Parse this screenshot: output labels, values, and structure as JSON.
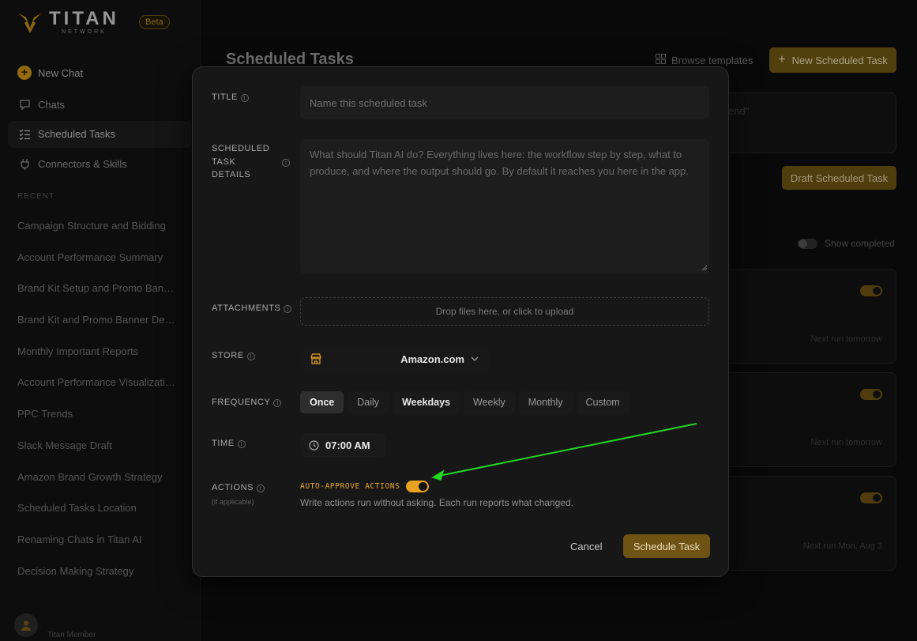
{
  "app": {
    "name": "TITAN",
    "sub": "NETWORK",
    "badge": "Beta",
    "accent": "#c48e12"
  },
  "sidebar": {
    "new_chat": "New Chat",
    "items": [
      {
        "label": "Chats",
        "icon": "chat-icon"
      },
      {
        "label": "Scheduled Tasks",
        "icon": "checklist-icon"
      },
      {
        "label": "Connectors & Skills",
        "icon": "plug-icon"
      }
    ],
    "recent_label": "RECENT",
    "recent": [
      "Campaign Structure and Bidding",
      "Account Performance Summary",
      "Brand Kit Setup and Promo Banner",
      "Brand Kit and Promo Banner Design",
      "Monthly Important Reports",
      "Account Performance Visualization",
      "PPC Trends",
      "Slack Message Draft",
      "Amazon Brand Growth Strategy",
      "Scheduled Tasks Location",
      "Renaming Chats in Titan AI",
      "Decision Making Strategy"
    ],
    "user": "Titan Member"
  },
  "main": {
    "title": "Scheduled Tasks",
    "browse": "Browse templates",
    "new_task": "New Scheduled Task",
    "input_hint": "end\"",
    "draft": "Draft Scheduled Task",
    "show_completed": "Show completed",
    "cards": [
      {
        "next": "Next run tomorrow"
      },
      {
        "next": "Next run tomorrow"
      },
      {
        "next": "Next run Mon, Aug 3"
      }
    ]
  },
  "modal": {
    "title_label": "TITLE",
    "title_placeholder": "Name this scheduled task",
    "details_label_1": "SCHEDULED",
    "details_label_2": "TASK",
    "details_label_3": "DETAILS",
    "details_placeholder": "What should Titan AI do? Everything lives here: the workflow step by step, what to produce, and where the output should go. By default it reaches you here in the app.",
    "attachments_label": "ATTACHMENTS",
    "dropzone": "Drop files here, or click to upload",
    "store_label": "STORE",
    "store_value": "Amazon.com",
    "frequency_label": "FREQUENCY",
    "frequency_options": [
      "Once",
      "Daily",
      "Weekdays",
      "Weekly",
      "Monthly",
      "Custom"
    ],
    "frequency_selected": "Once",
    "time_label": "TIME",
    "time_value": "07:00 AM",
    "actions_label": "ACTIONS",
    "actions_sub": "(if applicable)",
    "auto_approve": "AUTO-APPROVE ACTIONS",
    "auto_approve_on": true,
    "auto_desc": "Write actions run without asking. Each run reports what changed.",
    "cancel": "Cancel",
    "schedule": "Schedule Task"
  },
  "annotation": {
    "arrow_color": "#22d622"
  }
}
